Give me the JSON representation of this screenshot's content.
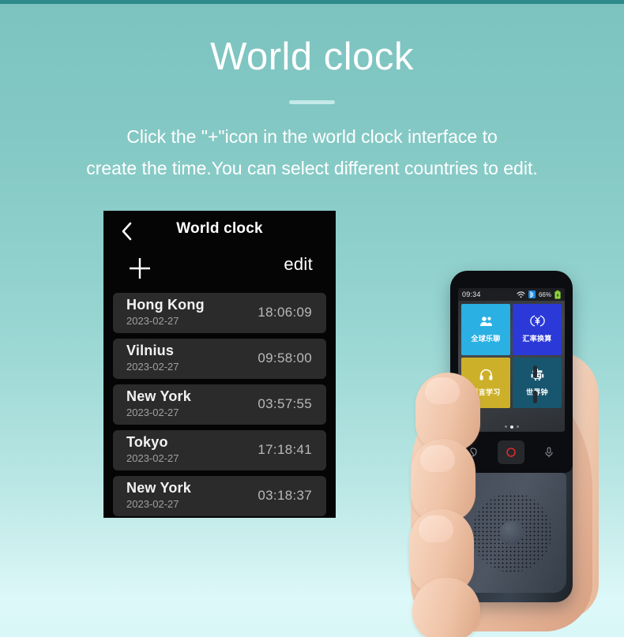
{
  "header": {
    "title": "World clock",
    "subtitle_line1": "Click the \"+\"icon in the world clock interface to",
    "subtitle_line2": "create the time.You can select different countries to edit.",
    "divider": "title-divider"
  },
  "clock_app": {
    "back_icon": "chevron-left-icon",
    "title": "World clock",
    "add_icon": "plus-icon",
    "edit_label": "edit",
    "rows": [
      {
        "city": "Hong Kong",
        "date": "2023-02-27",
        "time": "18:06:09"
      },
      {
        "city": "Vilnius",
        "date": "2023-02-27",
        "time": "09:58:00"
      },
      {
        "city": "New York",
        "date": "2023-02-27",
        "time": "03:57:55"
      },
      {
        "city": "Tokyo",
        "date": "2023-02-27",
        "time": "17:18:41"
      },
      {
        "city": "New York",
        "date": "2023-02-27",
        "time": "03:18:37"
      }
    ]
  },
  "device": {
    "status_bar": {
      "time": "09:34",
      "wifi_icon": "wifi-icon",
      "bluetooth_icon": "bluetooth-icon",
      "battery_percent": "66%",
      "battery_icon": "battery-icon"
    },
    "apps": [
      {
        "label": "全球乐聊",
        "icon": "people-icon",
        "color": "#2ab0e3"
      },
      {
        "label": "汇率换算",
        "icon": "currency-icon",
        "color": "#2b39d8"
      },
      {
        "label": "语言学习",
        "icon": "headphone-icon",
        "color": "#cdb02a"
      },
      {
        "label": "世界钟",
        "icon": "robot-icon",
        "color": "#17566e"
      }
    ],
    "page_dots": {
      "count": 3,
      "active_index": 1
    },
    "keys": [
      {
        "name": "translate-key",
        "icon": "speech-icon"
      },
      {
        "name": "record-key",
        "icon": "record-circle-icon"
      },
      {
        "name": "mic-key",
        "icon": "microphone-icon"
      }
    ],
    "speaker": "speaker-grille"
  },
  "colors": {
    "background_top": "#7cc3c0",
    "background_bottom": "#ddf8f8",
    "top_strip": "#2e8a8a",
    "panel_bg": "#050505",
    "row_bg": "#2b2b2b",
    "text_white": "#ffffff",
    "text_muted": "#a0a0a0"
  }
}
